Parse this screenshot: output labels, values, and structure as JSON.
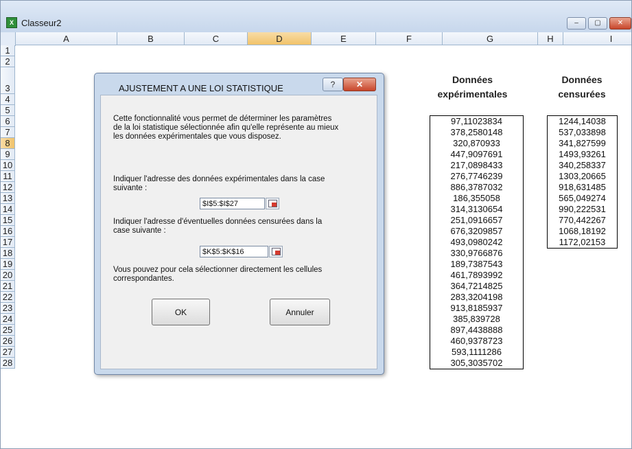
{
  "window": {
    "title": "Classeur2",
    "buttons": [
      "‒",
      "▢",
      "✕"
    ]
  },
  "columns": [
    "A",
    "B",
    "C",
    "D",
    "E",
    "F",
    "G",
    "H",
    "I"
  ],
  "selected_column": "D",
  "rows": [
    "1",
    "2",
    "3",
    "4",
    "5",
    "6",
    "7",
    "8",
    "9",
    "10",
    "11",
    "12",
    "13",
    "14",
    "15",
    "16",
    "17",
    "18",
    "19",
    "20",
    "21",
    "22",
    "23",
    "24",
    "25",
    "26",
    "27",
    "28"
  ],
  "selected_row": "8",
  "headers": {
    "experimental": [
      "Données",
      "expérimentales"
    ],
    "censored": [
      "Données",
      "censurées"
    ]
  },
  "experimental_data": [
    "97,11023834",
    "378,2580148",
    "320,870933",
    "447,9097691",
    "217,0898433",
    "276,7746239",
    "886,3787032",
    "186,355058",
    "314,3130654",
    "251,0916657",
    "676,3209857",
    "493,0980242",
    "330,9766876",
    "189,7387543",
    "461,7893992",
    "364,7214825",
    "283,3204198",
    "913,8185937",
    "385,839728",
    "897,4438888",
    "460,9378723",
    "593,1111286",
    "305,3035702"
  ],
  "censored_data": [
    "1244,14038",
    "537,033898",
    "341,827599",
    "1493,93261",
    "340,258337",
    "1303,20665",
    "918,631485",
    "565,049274",
    "990,222531",
    "770,442267",
    "1068,18192",
    "1172,02153"
  ],
  "dialog": {
    "title": "AJUSTEMENT A UNE LOI STATISTIQUE",
    "help_label": "?",
    "close_label": "✕",
    "intro": [
      "Cette fonctionnalité vous permet de déterminer les paramètres",
      "de la loi statistique sélectionnée afin qu'elle représente au mieux",
      "les données expérimentales que vous disposez."
    ],
    "exp_prompt": [
      "Indiquer l'adresse des données expérimentales dans la case",
      "suivante :"
    ],
    "exp_ref": "$I$5:$I$27",
    "cens_prompt": [
      "Indiquer l'adresse d'éventuelles données censurées dans la",
      "case suivante :"
    ],
    "cens_ref": "$K$5:$K$16",
    "hint": [
      "Vous pouvez pour cela sélectionner directement les cellules",
      "correspondantes."
    ],
    "ok_label": "OK",
    "cancel_label": "Annuler"
  },
  "colors": {
    "selection": "#f1c36a",
    "header": "#e2eaf5",
    "dialog_frame": "#c9d9ec"
  }
}
